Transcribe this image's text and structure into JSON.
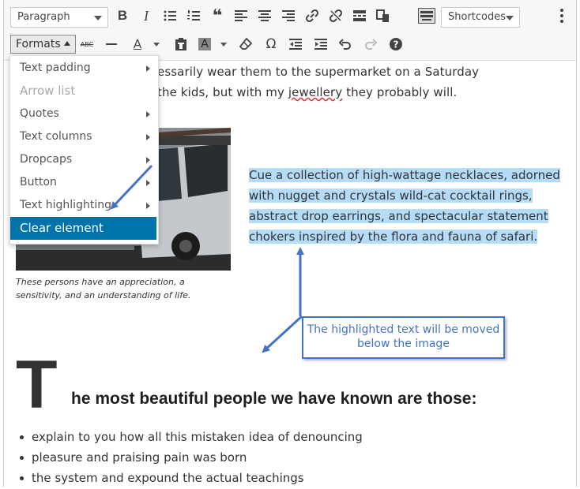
{
  "toolbar": {
    "block_format": "Paragraph",
    "shortcodes": "Shortcodes",
    "formats_label": "Formats",
    "strikethrough_glyph": "ABC",
    "text_color_glyph": "A",
    "bg_color_glyph": "A",
    "omega_glyph": "Ω"
  },
  "formats_menu": {
    "items": [
      {
        "label": "Text padding",
        "submenu": true
      },
      {
        "label": "Arrow list",
        "submenu": false,
        "disabled": true
      },
      {
        "label": "Quotes",
        "submenu": true
      },
      {
        "label": "Text columns",
        "submenu": true
      },
      {
        "label": "Dropcaps",
        "submenu": true
      },
      {
        "label": "Button",
        "submenu": true
      },
      {
        "label": "Text highlighting",
        "submenu": true
      },
      {
        "label": "Clear element",
        "submenu": false,
        "active": true
      }
    ]
  },
  "content": {
    "line1": "essarily wear them to the supermarket on a Saturday",
    "line2_a": "the kids, but with my ",
    "line2_spell": "jewellery",
    "line2_b": " they probably will.",
    "caption": "These persons have an appreciation, a sensitivity, and an understanding of life.",
    "highlight_lines": [
      "Cue a collection of high-wattage necklaces, adorned",
      "with nugget and crystals wild-cat cocktail rings,",
      "abstract drop earrings, and spectacular statement",
      "chokers inspired by the flora and fauna of safari."
    ],
    "dropcap": "T",
    "heading": "he most beautiful people we have known are those:",
    "bullets": [
      "explain to you how all this mistaken idea of denouncing",
      "pleasure and praising pain was born",
      "the system and expound the actual teachings"
    ]
  },
  "callout": {
    "line1": "The highlighted text will be moved",
    "line2": "below the image"
  },
  "colors": {
    "accent": "#0073aa",
    "highlight": "#b4dcf7",
    "annotation": "#4472c4"
  }
}
